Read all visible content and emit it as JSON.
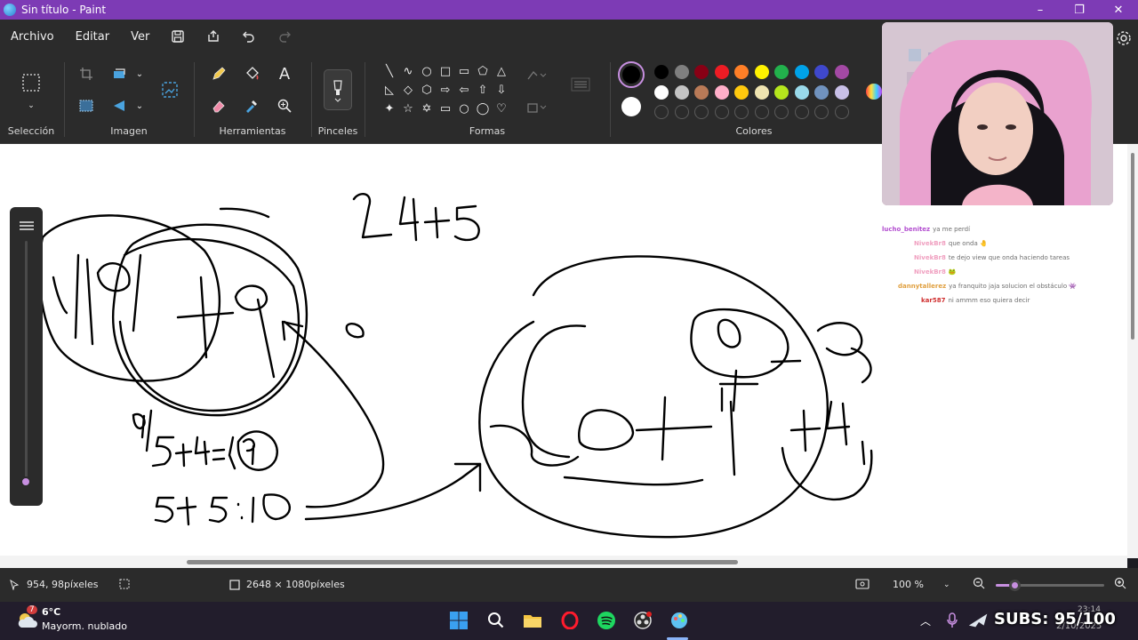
{
  "window": {
    "title": "Sin título - Paint",
    "minimize": "–",
    "maximize": "❐",
    "close": "✕"
  },
  "menu": {
    "file": "Archivo",
    "edit": "Editar",
    "view": "Ver"
  },
  "ribbon": {
    "groups": {
      "selection": "Selección",
      "image": "Imagen",
      "tools": "Herramientas",
      "brushes": "Pinceles",
      "shapes": "Formas",
      "colors": "Colores"
    },
    "shapes_glyphs": [
      "╲",
      "∿",
      "○",
      "□",
      "▭",
      "⬠",
      "△",
      "◺",
      "◇",
      "⬡",
      "⇨",
      "⇦",
      "⇧",
      "⇩",
      "✦",
      "☆",
      "✡",
      "▭",
      "○",
      "◯",
      "♡"
    ],
    "palette_row1": [
      "#000000",
      "#7f7f7f",
      "#880015",
      "#ed1c24",
      "#ff7f27",
      "#fff200",
      "#22b14c",
      "#00a2e8",
      "#3f48cc",
      "#a349a4"
    ],
    "palette_row2": [
      "#ffffff",
      "#c3c3c3",
      "#b97a57",
      "#ffaec9",
      "#ffc90e",
      "#efe4b0",
      "#b5e61d",
      "#99d9ea",
      "#7092be",
      "#c8bfe7"
    ],
    "primary_color": "#000000",
    "secondary_color": "#ffffff",
    "text_tool": "A"
  },
  "canvas": {
    "handwriting_1": "24+5",
    "handwriting_2": "9/5+4=(9)",
    "handwriting_3": "5+5:10"
  },
  "status": {
    "cursor_pos": "954, 98píxeles",
    "canvas_size": "2648 × 1080píxeles",
    "zoom": "100 %",
    "zoom_level_fraction": 0.17
  },
  "chat": [
    {
      "user": "lucho_benitez",
      "color": "#b34fd0",
      "text": "ya me perdí"
    },
    {
      "user": "NivekBr8",
      "color": "#f0a0c0",
      "text": "que onda 🤚"
    },
    {
      "user": "NivekBr8",
      "color": "#f0a0c0",
      "text": "te dejo view que onda haciendo tareas"
    },
    {
      "user": "NivekBr8",
      "color": "#f0a0c0",
      "text": "🐸"
    },
    {
      "user": "dannytallerez",
      "color": "#e0a040",
      "text": "ya franquito jaja solucion el obstáculo 👾"
    },
    {
      "user": "kar587",
      "color": "#d03030",
      "text": "ni ammm eso quiera decir"
    }
  ],
  "taskbar": {
    "weather_temp": "6°C",
    "weather_desc": "Mayorm. nublado",
    "weather_badge": "7",
    "clock_time": "23:14",
    "clock_date": "2/10/2025",
    "subs": "SUBS: 95/100"
  }
}
